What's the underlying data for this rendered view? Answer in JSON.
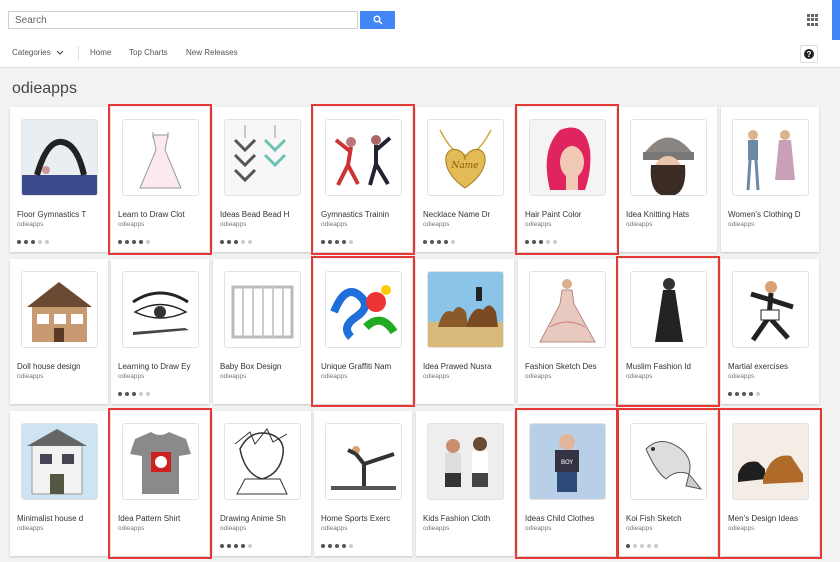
{
  "search": {
    "placeholder": "Search"
  },
  "nav": {
    "categories": "Categories",
    "home": "Home",
    "top_charts": "Top Charts",
    "new_releases": "New Releases"
  },
  "page": {
    "title": "odieapps"
  },
  "cards": [
    {
      "title": "Floor Gymnastics T",
      "developer": "odieapps",
      "rating": 3,
      "highlighted": false,
      "thumb": "gymnast-bridge"
    },
    {
      "title": "Learn to Draw Clot",
      "developer": "odieapps",
      "rating": 4,
      "highlighted": true,
      "thumb": "dress-sketch"
    },
    {
      "title": "Ideas Bead Bead H",
      "developer": "odieapps",
      "rating": 3,
      "highlighted": false,
      "thumb": "bead-pattern"
    },
    {
      "title": "Gymnastics Trainin",
      "developer": "odieapps",
      "rating": 4,
      "highlighted": true,
      "thumb": "gymnasts-pair"
    },
    {
      "title": "Necklace Name Dr",
      "developer": "odieapps",
      "rating": 4,
      "highlighted": false,
      "thumb": "gold-necklace"
    },
    {
      "title": "Hair Paint Color",
      "developer": "odieapps",
      "rating": 3,
      "highlighted": true,
      "thumb": "pink-hair"
    },
    {
      "title": "Idea Knitting Hats",
      "developer": "odieapps",
      "rating": 0,
      "highlighted": false,
      "thumb": "knit-hat"
    },
    {
      "title": "Women's Clothing D",
      "developer": "odieapps",
      "rating": 0,
      "highlighted": false,
      "thumb": "women-figures"
    },
    {
      "title": "Doll house design",
      "developer": "odieapps",
      "rating": 0,
      "highlighted": false,
      "thumb": "doll-house"
    },
    {
      "title": "Learning to Draw Ey",
      "developer": "odieapps",
      "rating": 3,
      "highlighted": false,
      "thumb": "eye-drawing"
    },
    {
      "title": "Baby Box Design",
      "developer": "odieapps",
      "rating": 0,
      "highlighted": false,
      "thumb": "baby-crib"
    },
    {
      "title": "Unique Graffiti Nam",
      "developer": "odieapps",
      "rating": 0,
      "highlighted": true,
      "thumb": "graffiti"
    },
    {
      "title": "Idea Prawed Nusra",
      "developer": "odieapps",
      "rating": 0,
      "highlighted": false,
      "thumb": "camels"
    },
    {
      "title": "Fashion Sketch Des",
      "developer": "odieapps",
      "rating": 0,
      "highlighted": false,
      "thumb": "fashion-gown"
    },
    {
      "title": "Muslim Fashion Id",
      "developer": "odieapps",
      "rating": 0,
      "highlighted": true,
      "thumb": "abaya"
    },
    {
      "title": "Martial exercises",
      "developer": "odieapps",
      "rating": 4,
      "highlighted": false,
      "thumb": "martial-artist"
    },
    {
      "title": "Minimalist house d",
      "developer": "odieapps",
      "rating": 0,
      "highlighted": false,
      "thumb": "house"
    },
    {
      "title": "Idea Pattern Shirt",
      "developer": "odieapps",
      "rating": 0,
      "highlighted": true,
      "thumb": "tshirt"
    },
    {
      "title": "Drawing Anime Sh",
      "developer": "odieapps",
      "rating": 4,
      "highlighted": false,
      "thumb": "anime-sketch"
    },
    {
      "title": "Home Sports Exerc",
      "developer": "odieapps",
      "rating": 4,
      "highlighted": false,
      "thumb": "yoga-pose"
    },
    {
      "title": "Kids Fashion Cloth",
      "developer": "odieapps",
      "rating": 0,
      "highlighted": false,
      "thumb": "kids-photo"
    },
    {
      "title": "Ideas Child Clothes",
      "developer": "odieapps",
      "rating": 0,
      "highlighted": true,
      "thumb": "child-boy"
    },
    {
      "title": "Koi Fish Sketch",
      "developer": "odieapps",
      "rating": 1,
      "highlighted": true,
      "thumb": "koi-fish"
    },
    {
      "title": "Men's Design Ideas",
      "developer": "odieapps",
      "rating": 0,
      "highlighted": true,
      "thumb": "mens-shoes"
    }
  ]
}
